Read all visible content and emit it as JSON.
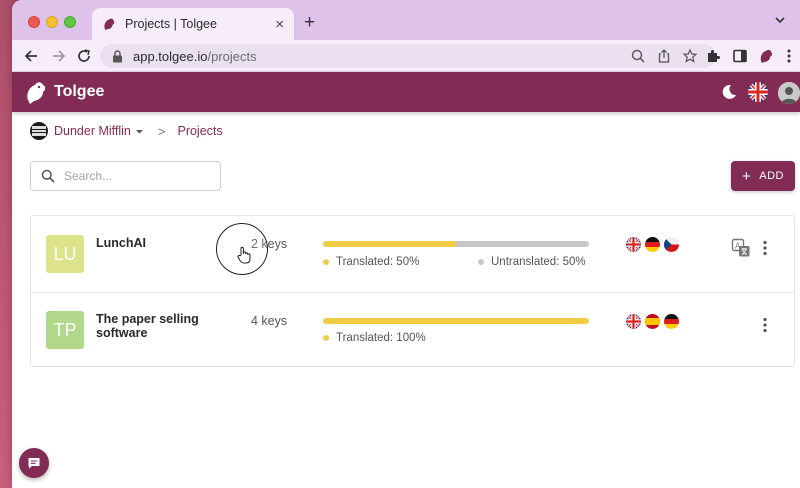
{
  "browser": {
    "tab_title": "Projects | Tolgee",
    "url_host": "app.tolgee.io",
    "url_path": "/projects"
  },
  "app": {
    "name": "Tolgee",
    "brand_color": "#822c55"
  },
  "breadcrumb": {
    "organization": "Dunder Mifflin",
    "current": "Projects",
    "separator": ">"
  },
  "search": {
    "placeholder": "Search..."
  },
  "toolbar": {
    "add_label": "ADD",
    "add_icon": "+"
  },
  "projects": [
    {
      "initials": "LU",
      "avatar_color": "#dde38a",
      "name": "LunchAI",
      "keys": "2 keys",
      "translated_fraction": 0.5,
      "translated_label": "Translated: 50%",
      "untranslated_label": "Untranslated: 50%",
      "languages": [
        "en-GB",
        "de",
        "cs"
      ]
    },
    {
      "initials": "TP",
      "avatar_color": "#b2d88c",
      "name": "The paper selling software",
      "keys": "4 keys",
      "translated_fraction": 1.0,
      "translated_label": "Translated: 100%",
      "languages": [
        "en-GB",
        "es",
        "de"
      ]
    }
  ],
  "colors": {
    "translated": "#f1cc45",
    "untranslated": "#c7c7c7"
  }
}
